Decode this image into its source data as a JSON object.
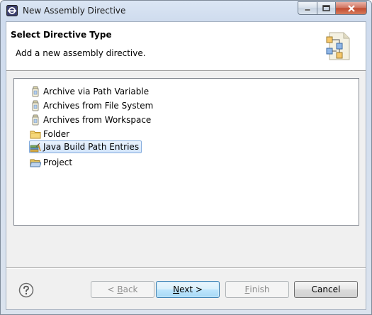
{
  "window": {
    "title": "New Assembly Directive",
    "icon": "eclipse-icon"
  },
  "header": {
    "title": "Select Directive Type",
    "description": "Add a new assembly directive.",
    "graphic": "wizard-banner-icon"
  },
  "tree": {
    "items": [
      {
        "label": "Archive via Path Variable",
        "icon": "jar-icon",
        "selected": false
      },
      {
        "label": "Archives from File System",
        "icon": "jar-icon",
        "selected": false
      },
      {
        "label": "Archives from Workspace",
        "icon": "jar-icon",
        "selected": false
      },
      {
        "label": "Folder",
        "icon": "folder-icon",
        "selected": false
      },
      {
        "label": "Java Build Path Entries",
        "icon": "library-icon",
        "selected": true
      },
      {
        "label": "Project",
        "icon": "project-folder-icon",
        "selected": false
      }
    ]
  },
  "buttons": {
    "back": {
      "prefix": "< ",
      "mnemonic": "B",
      "rest": "ack",
      "enabled": false
    },
    "next": {
      "mnemonic": "N",
      "rest": "ext >",
      "enabled": true
    },
    "finish": {
      "mnemonic": "F",
      "rest": "inish",
      "enabled": false
    },
    "cancel": {
      "label": "Cancel",
      "enabled": true
    }
  },
  "colors": {
    "selection_border": "#84acdd",
    "default_button_border": "#3c7fb1"
  }
}
